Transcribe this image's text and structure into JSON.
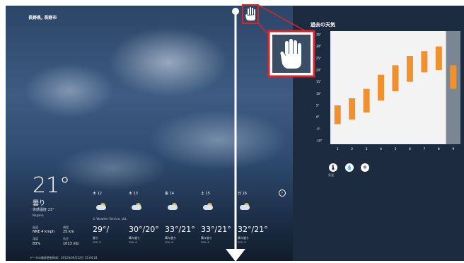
{
  "location": "長野県, 長野市",
  "current": {
    "temperature": "21°",
    "condition": "曇り",
    "feels_like": "体感温度 21°",
    "station": "Nagano",
    "stats": [
      {
        "label": "風速",
        "value": "NNE 4 kmph"
      },
      {
        "label": "視程",
        "value": "25 km"
      },
      {
        "label": "湿度",
        "value": "83%"
      },
      {
        "label": "気圧",
        "value": "1013 mb"
      }
    ]
  },
  "provider": "© Weather Service, Ltd.",
  "forecast": [
    {
      "day": "木 12",
      "temps": "29°/",
      "cond": "曇り",
      "rain": "20% ☂"
    },
    {
      "day": "木 13",
      "temps": "30°/20°",
      "cond": "晴々曇り",
      "rain": "20% ☂"
    },
    {
      "day": "金 14",
      "temps": "33°/21°",
      "cond": "晴々曇り",
      "rain": "20% ☂"
    },
    {
      "day": "土 15",
      "temps": "33°/21°",
      "cond": "晴々曇り",
      "rain": "20% ☂"
    },
    {
      "day": "日 16",
      "temps": "32°/21°",
      "cond": "晴々曇り",
      "rain": "20% ☂"
    }
  ],
  "footer": "データの最終更新時刻：2012年09月12日 15:04:24",
  "history": {
    "title": "過去の天気",
    "legend_label": "気温"
  },
  "chart_data": {
    "type": "bar",
    "title": "過去の天気",
    "categories": [
      "1",
      "2",
      "3",
      "4",
      "5",
      "6",
      "7",
      "8",
      "9"
    ],
    "y_ticks": [
      "35°",
      "30°",
      "25°",
      "20°",
      "15°",
      "10°",
      "5°",
      "0°",
      "-5°",
      "-10°"
    ],
    "ylim": [
      -10,
      35
    ],
    "series": [
      {
        "values": [
          [
            -3,
            5
          ],
          [
            -1,
            8
          ],
          [
            2,
            12
          ],
          [
            7,
            18
          ],
          [
            11,
            22
          ],
          [
            15,
            26
          ],
          [
            19,
            28
          ],
          [
            20,
            30
          ],
          [
            12,
            22
          ]
        ]
      }
    ],
    "highlight_category": "9",
    "color": "#ef9131"
  },
  "colors": {
    "bar": "#ef9131",
    "annotation": "#d9262c",
    "panel": "#1d2b40"
  }
}
